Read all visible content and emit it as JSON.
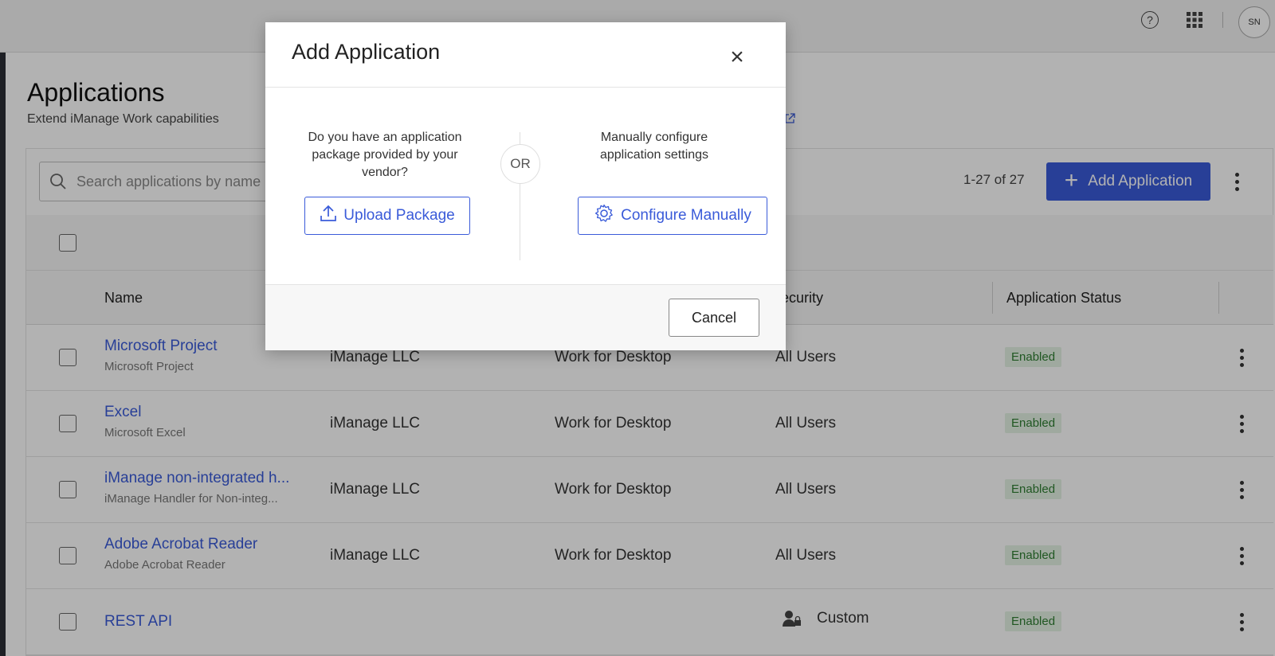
{
  "topbar": {
    "avatar_initials": "SN",
    "help_icon": "help-circle-icon",
    "apps_icon": "app-grid-icon"
  },
  "page": {
    "title": "Applications",
    "subtitle": "Extend iManage Work capabilities"
  },
  "toolbar": {
    "search_placeholder": "Search applications by name",
    "count": "1-27 of 27",
    "add_label": "Add Application"
  },
  "table": {
    "headers": [
      "Name",
      "Security",
      "Application Status"
    ],
    "rows": [
      {
        "name": "Microsoft Project",
        "desc": "Microsoft Project",
        "vendor": "iManage LLC",
        "type": "Work for Desktop",
        "security": "All Users",
        "status": "Enabled"
      },
      {
        "name": "Excel",
        "desc": "Microsoft Excel",
        "vendor": "iManage LLC",
        "type": "Work for Desktop",
        "security": "All Users",
        "status": "Enabled"
      },
      {
        "name": "iManage non-integrated h...",
        "desc": "iManage Handler for Non-integ...",
        "vendor": "iManage LLC",
        "type": "Work for Desktop",
        "security": "All Users",
        "status": "Enabled"
      },
      {
        "name": "Adobe Acrobat Reader",
        "desc": "Adobe Acrobat Reader",
        "vendor": "iManage LLC",
        "type": "Work for Desktop",
        "security": "All Users",
        "status": "Enabled"
      },
      {
        "name": "REST API",
        "desc": "",
        "vendor": "",
        "type": "",
        "security": "Custom",
        "status": "Enabled"
      }
    ]
  },
  "modal": {
    "title": "Add Application",
    "left_prompt": "Do you have an application package provided by your vendor?",
    "or_label": "OR",
    "right_prompt": "Manually configure application settings",
    "upload_label": "Upload Package",
    "configure_label": "Configure Manually",
    "cancel_label": "Cancel"
  },
  "colors": {
    "accent": "#3a5bd9",
    "enabled_bg": "#e4f3e4",
    "enabled_text": "#2e7d32"
  }
}
